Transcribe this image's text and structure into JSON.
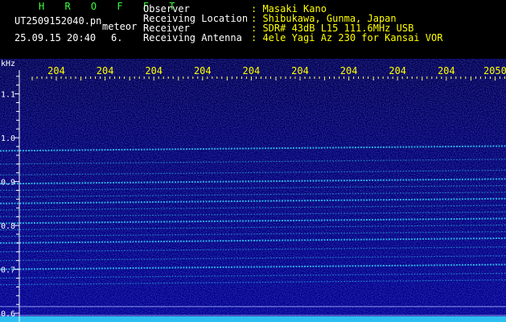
{
  "header": {
    "title": "H R O F F T",
    "file_name": "UT2509152040.pn",
    "tag": "meteor",
    "datetime": "25.09.15 20:40",
    "number": "6.",
    "fields": [
      {
        "label": "Observer",
        "value": ": Masaki Kano"
      },
      {
        "label": "Receiving Location",
        "value": ": Shibukawa, Gunma, Japan"
      },
      {
        "label": "Receiver",
        "value": ": SDR# 43dB L15 111.6MHz USB"
      },
      {
        "label": "Receiving Antenna",
        "value": ": 4ele Yagi Az 230 for Kansai VOR"
      }
    ]
  },
  "plot": {
    "y_unit": "kHz",
    "y_ticks": [
      "1.1",
      "1.0",
      "0.9",
      "0.8",
      "0.7",
      "0.6"
    ],
    "y_tick_values": [
      1.1,
      1.0,
      0.9,
      0.8,
      0.7,
      0.6
    ],
    "y_range": [
      0.58,
      1.18
    ],
    "x_ticks": [
      "204",
      "204",
      "204",
      "204",
      "204",
      "204",
      "204",
      "204",
      "204",
      "2050"
    ],
    "colors": {
      "background": "#000088",
      "signal": "#33ddff",
      "axis": "#ffffff"
    }
  }
}
